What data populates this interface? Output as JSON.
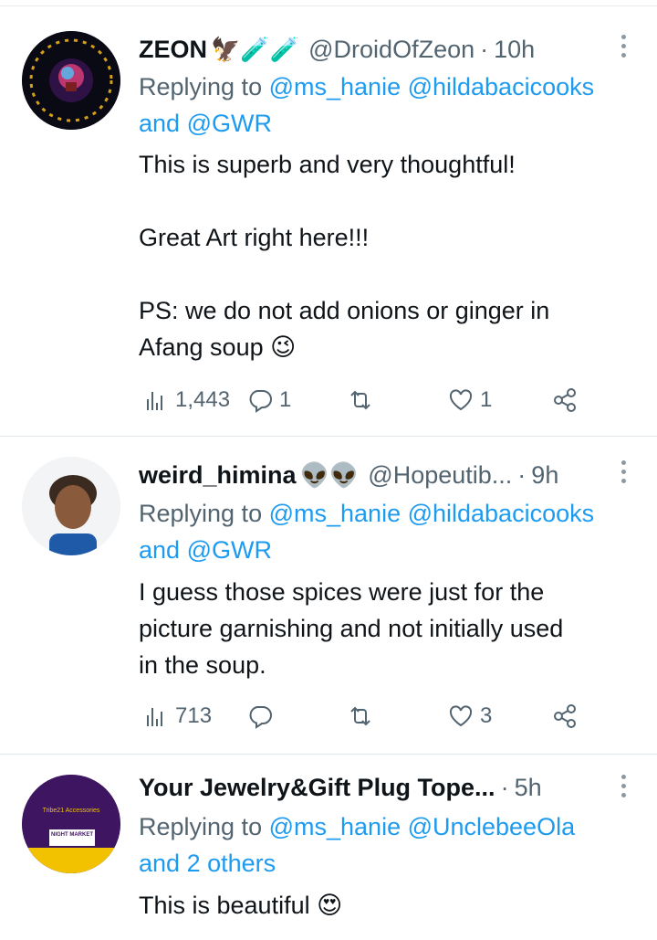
{
  "tweets": [
    {
      "name": "ZEON",
      "name_emojis": "🦅🧪🧪",
      "handle": "@DroidOfZeon",
      "separator": "·",
      "time": "10h",
      "reply_prefix": "Replying to",
      "reply_line1": "@ms_hanie @hildabacicooks",
      "reply_and": "and",
      "reply_line2": "@GWR",
      "body": [
        "This is superb and very thoughtful!",
        "",
        "Great Art right here!!!",
        "",
        "PS: we do not add onions or ginger in",
        "Afang soup 😉"
      ],
      "views": "1,443",
      "replies": "1",
      "retweets": "",
      "likes": "1"
    },
    {
      "name": "weird_himina",
      "name_emojis": "👽👽",
      "handle": "@Hopeutib...",
      "separator": "·",
      "time": "9h",
      "reply_prefix": "Replying to",
      "reply_line1": "@ms_hanie @hildabacicooks",
      "reply_and": "and",
      "reply_line2": "@GWR",
      "body": [
        "I guess those spices were just for the",
        "picture garnishing and not initially used",
        "in the soup."
      ],
      "views": "713",
      "replies": "",
      "retweets": "",
      "likes": "3"
    },
    {
      "name": "Your Jewelry&Gift Plug Tope...",
      "name_emojis": "",
      "handle": "",
      "separator": "·",
      "time": "5h",
      "reply_prefix": "Replying to",
      "reply_line1": "@ms_hanie @UnclebeeOla",
      "reply_and": "and",
      "reply_line2": "2 others",
      "body": [
        "This is beautiful 😍"
      ],
      "avatar_text": [
        "Tribe21 Accessories",
        "NIGHT MARKET"
      ]
    }
  ],
  "colors": {
    "link": "#1d9bf0",
    "muted": "#536471",
    "text": "#0f1419"
  }
}
